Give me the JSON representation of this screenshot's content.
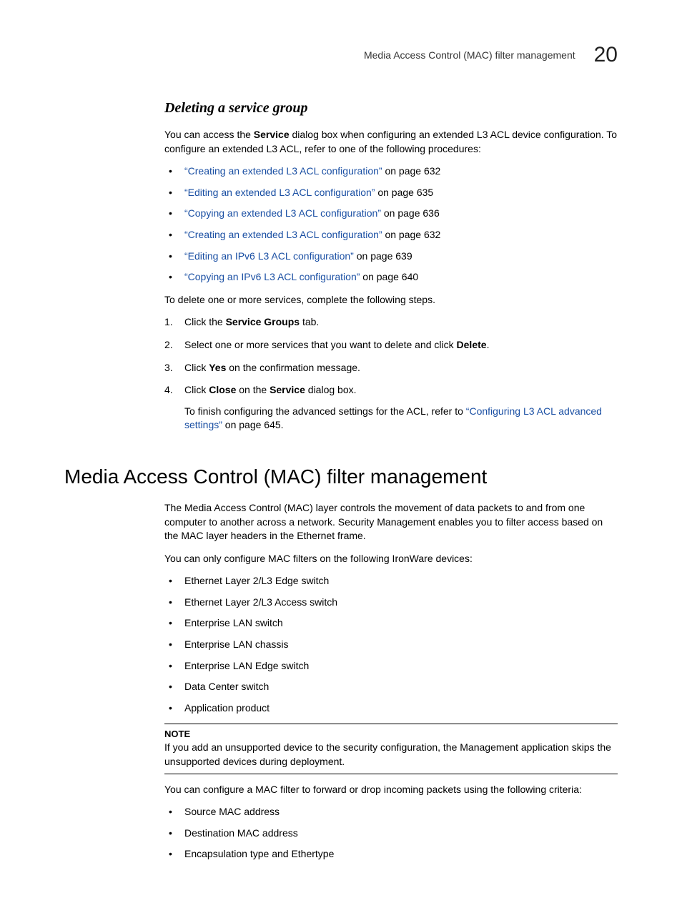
{
  "header": {
    "running_title": "Media Access Control (MAC) filter management",
    "chapter_number": "20"
  },
  "section1": {
    "heading": "Deleting a service group",
    "intro_part1": "You can access the ",
    "intro_bold1": "Service",
    "intro_part2": " dialog box when configuring an extended L3 ACL device configuration. To configure an extended L3 ACL, refer to one of the following procedures:",
    "links": [
      {
        "text": "“Creating an extended L3 ACL configuration”",
        "page": " on page 632"
      },
      {
        "text": "“Editing an extended L3 ACL configuration”",
        "page": " on page 635"
      },
      {
        "text": "“Copying an extended L3 ACL configuration”",
        "page": " on page 636"
      },
      {
        "text": "“Creating an extended L3 ACL configuration”",
        "page": " on page 632"
      },
      {
        "text": "“Editing an IPv6 L3 ACL configuration”",
        "page": " on page 639"
      },
      {
        "text": "“Copying an IPv6 L3 ACL configuration”",
        "page": " on page 640"
      }
    ],
    "lead": "To delete one or more services, complete the following steps.",
    "step1": {
      "a": "Click the ",
      "b": "Service Groups",
      "c": " tab."
    },
    "step2": {
      "a": "Select one or more services that you want to delete and click ",
      "b": "Delete",
      "c": "."
    },
    "step3": {
      "a": "Click ",
      "b": "Yes",
      "c": " on the confirmation message."
    },
    "step4": {
      "a": "Click ",
      "b": "Close",
      "c": " on the ",
      "d": "Service",
      "e": " dialog box."
    },
    "step4_sub": {
      "a": "To finish configuring the advanced settings for the ACL, refer to ",
      "link": "“Configuring L3 ACL advanced settings”",
      "b": " on page 645."
    }
  },
  "section2": {
    "heading": "Media Access Control (MAC) filter management",
    "para1": "The Media Access Control (MAC) layer controls the movement of data packets to and from one computer to another across a network. Security Management enables you to filter access based on the MAC layer headers in the Ethernet frame.",
    "para2": "You can only configure MAC filters on the following IronWare devices:",
    "devices": [
      "Ethernet Layer 2/L3 Edge switch",
      "Ethernet Layer 2/L3 Access switch",
      "Enterprise LAN switch",
      "Enterprise LAN chassis",
      "Enterprise LAN Edge switch",
      "Data Center switch",
      "Application product"
    ],
    "note_label": "NOTE",
    "note_text": "If you add an unsupported device to the security configuration, the Management application skips the unsupported devices during deployment.",
    "para3": "You can configure a MAC filter to forward or drop incoming packets using the following criteria:",
    "criteria": [
      "Source MAC address",
      "Destination MAC address",
      "Encapsulation type and Ethertype"
    ]
  }
}
